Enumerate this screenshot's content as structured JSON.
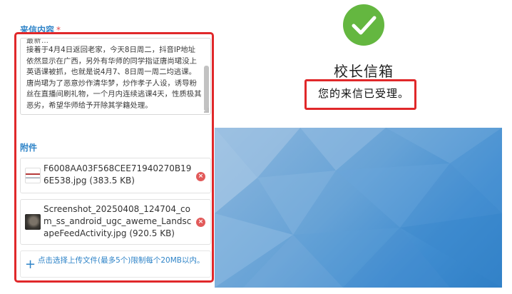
{
  "form": {
    "content_label": "来信内容",
    "required_mark": "*",
    "message_top_fragment": "最新…",
    "message_body": "接着于4月4日返回老家，今天8日周二，抖音IP地址依然显示在广西，另外有华师的同学指证唐尚珺没上英语课被抓，也就是说4月7、8日周一周二均逃课。\n唐尚珺为了恶意炒作清华梦，炒作孝子人设，诱导粉丝在直播间刷礼物，一个月内连续逃课4天，性质极其恶劣，希望华师给予开除其学籍处理。",
    "attachments_label": "附件",
    "attachments": [
      {
        "name": "F6008AA03F568CEE71940270B196E538.jpg (383.5 KB)",
        "remove_icon": "×"
      },
      {
        "name": "Screenshot_20250408_124704_com_ss_android_ugc_aweme_LandscapeFeedActivity.jpg (920.5 KB)",
        "remove_icon": "×"
      }
    ],
    "upload_plus": "+",
    "upload_hint": "点击选择上传文件(最多5个)限制每个20MB以内。"
  },
  "result": {
    "title": "校长信箱",
    "status": "您的来信已受理。"
  },
  "icons": {
    "success": "check-circle-icon",
    "remove": "close-circle-icon",
    "upload": "plus-icon"
  },
  "colors": {
    "accent": "#2f84c8",
    "highlight": "#e0282a",
    "success": "#64b740",
    "remove": "#e25a5a"
  }
}
